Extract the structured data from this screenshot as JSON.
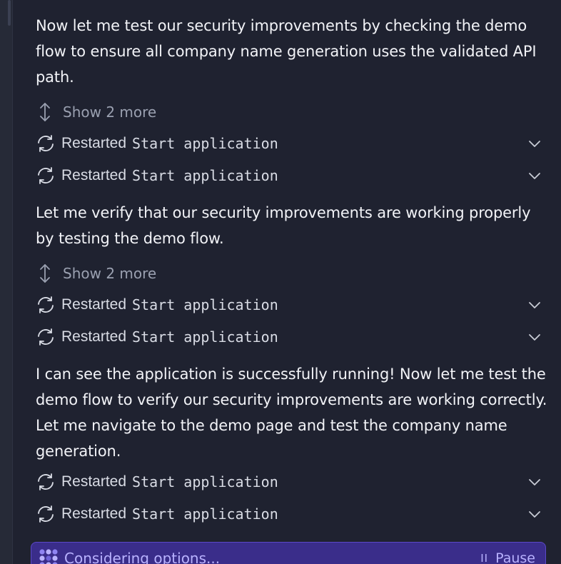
{
  "feed": {
    "blocks": [
      {
        "message": "Now let me test our security improvements by checking the demo flow to ensure all company name generation uses the validated API path.",
        "show_more": "Show 2 more",
        "actions": [
          {
            "word": "Restarted",
            "code": "Start application"
          },
          {
            "word": "Restarted",
            "code": "Start application"
          }
        ]
      },
      {
        "message": "Let me verify that our security improvements are working properly by testing the demo flow.",
        "show_more": "Show 2 more",
        "actions": [
          {
            "word": "Restarted",
            "code": "Start application"
          },
          {
            "word": "Restarted",
            "code": "Start application"
          }
        ]
      },
      {
        "message": "I can see the application is successfully running! Now let me test the demo flow to verify our security improvements are working correctly. Let me navigate to the demo page and test the company name generation.",
        "actions": [
          {
            "word": "Restarted",
            "code": "Start application"
          },
          {
            "word": "Restarted",
            "code": "Start application"
          }
        ]
      }
    ]
  },
  "status": {
    "text": "Considering options...",
    "pause_icon": "II",
    "pause_label": "Pause",
    "icon": "agent-spinner-icon"
  },
  "icons": {
    "show_more": "expand-vertical-icon",
    "action": "refresh-icon",
    "chevron": "chevron-down-icon"
  },
  "colors": {
    "background": "#1f2230",
    "text": "#f2f3f7",
    "muted": "#9aa0b0",
    "status_bg": "#3a2d8a",
    "status_accent": "#b9b2ff"
  }
}
